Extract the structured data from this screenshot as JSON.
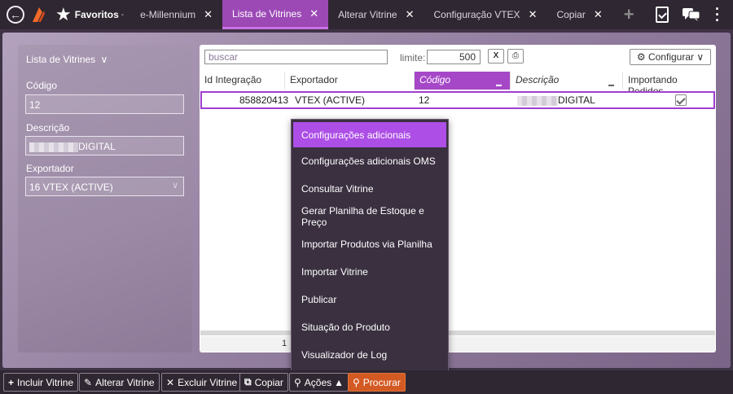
{
  "topbar": {
    "favorites_label": "Favoritos",
    "favorites_arrow": "-",
    "tabs": [
      {
        "label": "e-Millennium",
        "close": "✕"
      },
      {
        "label": "Lista de Vitrines",
        "close": "✕"
      },
      {
        "label": "Alterar Vitrine",
        "close": "✕"
      },
      {
        "label": "Configuração VTEX",
        "close": "✕"
      },
      {
        "label": "Copiar",
        "close": "✕"
      }
    ],
    "icons": [
      "back-icon",
      "logo-icon",
      "star-icon",
      "plus-icon",
      "clipboard-icon",
      "chat-icon",
      "kebab-icon"
    ]
  },
  "left_panel": {
    "title": "Lista de Vitrines",
    "title_arrow": "∨",
    "codigo_label": "Código",
    "codigo_value": "12",
    "descricao_label": "Descrição",
    "descricao_value": "DIGITAL",
    "exportador_label": "Exportador",
    "exportador_value": "16 VTEX (ACTIVE)"
  },
  "toolbar": {
    "search_placeholder": "buscar",
    "limit_label": "limite:",
    "limit_value": "500",
    "excel_icon": "X",
    "print_icon": "⎙",
    "config_label": "Configurar"
  },
  "grid": {
    "columns": [
      "Id Integração",
      "Exportador",
      "Código",
      "Descrição",
      "Importando Pedidos"
    ],
    "rows": [
      {
        "id_integracao": "858820413",
        "exportador": "VTEX (ACTIVE)",
        "codigo": "12",
        "descricao": "DIGITAL",
        "importando_pedidos": true
      }
    ],
    "page": "1"
  },
  "actions_menu": {
    "items": [
      "Configurações adicionais",
      "Configurações adicionais OMS",
      "Consultar Vitrine",
      "Gerar Planilha de Estoque e Preço",
      "Importar Produtos via Planilha",
      "Importar Vitrine",
      "Publicar",
      "Situação do Produto",
      "Visualizador de Log"
    ],
    "highlighted_index": 0
  },
  "bottombar": {
    "incluir": "Incluir Vitrine",
    "alterar": "Alterar Vitrine",
    "excluir": "Excluir Vitrine",
    "copiar": "Copiar",
    "acoes": "Ações",
    "procurar": "Procurar"
  },
  "colors": {
    "accent": "#a647c8",
    "topbar_bg": "#2f2731",
    "menu_bg": "#3a3040",
    "procurar_bg": "#d35a23"
  }
}
